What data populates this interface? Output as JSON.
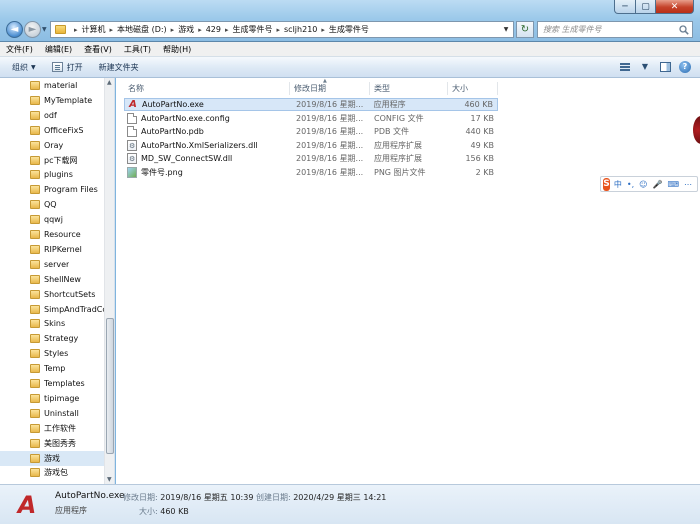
{
  "window": {
    "minimize": "─",
    "maximize": "▢",
    "close": "✕"
  },
  "nav": {
    "back": "◄",
    "forward": "►",
    "dropdown": "▼",
    "refresh": "↻"
  },
  "address": {
    "crumbs": [
      "计算机",
      "本地磁盘 (D:)",
      "游戏",
      "429",
      "生成零件号",
      "scljh210",
      "生成零件号"
    ]
  },
  "search": {
    "placeholder": "搜索 生成零件号"
  },
  "menu": {
    "items": [
      "文件(F)",
      "编辑(E)",
      "查看(V)",
      "工具(T)",
      "帮助(H)"
    ]
  },
  "toolbar": {
    "organize": "组织",
    "open": "打开",
    "new_folder": "新建文件夹",
    "dropdown_arrow": "▼"
  },
  "sidebar": {
    "items": [
      "material",
      "MyTemplate",
      "odf",
      "OfficeFixS",
      "Oray",
      "pc下载网",
      "plugins",
      "Program Files",
      "QQ",
      "qqwj",
      "Resource",
      "RIPKernel",
      "server",
      "ShellNew",
      "ShortcutSets",
      "SimpAndTradCc",
      "Skins",
      "Strategy",
      "Styles",
      "Temp",
      "Templates",
      "tipimage",
      "Uninstall",
      "工作软件",
      "美图秀秀",
      "游戏",
      "游戏包"
    ],
    "selected_index": 25
  },
  "columns": {
    "name": "名称",
    "date": "修改日期",
    "type": "类型",
    "size": "大小"
  },
  "files": [
    {
      "name": "AutoPartNo.exe",
      "date": "2019/8/16 星期...",
      "type": "应用程序",
      "size": "460 KB",
      "icon": "exe-icon"
    },
    {
      "name": "AutoPartNo.exe.config",
      "date": "2019/8/16 星期...",
      "type": "CONFIG 文件",
      "size": "17 KB",
      "icon": "file-icon"
    },
    {
      "name": "AutoPartNo.pdb",
      "date": "2019/8/16 星期...",
      "type": "PDB 文件",
      "size": "440 KB",
      "icon": "file-icon"
    },
    {
      "name": "AutoPartNo.XmlSerializers.dll",
      "date": "2019/8/16 星期...",
      "type": "应用程序扩展",
      "size": "49 KB",
      "icon": "dll-icon"
    },
    {
      "name": "MD_SW_ConnectSW.dll",
      "date": "2019/8/16 星期...",
      "type": "应用程序扩展",
      "size": "156 KB",
      "icon": "dll-icon"
    },
    {
      "name": "零件号.png",
      "date": "2019/8/16 星期...",
      "type": "PNG 图片文件",
      "size": "2 KB",
      "icon": "image-icon"
    }
  ],
  "ime": {
    "logo": "S",
    "mode": "中",
    "punct": "•,",
    "emoji": "☺",
    "voice": "🎤",
    "keyboard": "⌨",
    "more": "⋯"
  },
  "details": {
    "name": "AutoPartNo.exe",
    "type": "应用程序",
    "modified_label": "修改日期:",
    "modified_value": "2019/8/16 星期五 10:39",
    "created_label": "创建日期:",
    "created_value": "2020/4/29 星期三 14:21",
    "size_label": "大小:",
    "size_value": "460 KB"
  }
}
